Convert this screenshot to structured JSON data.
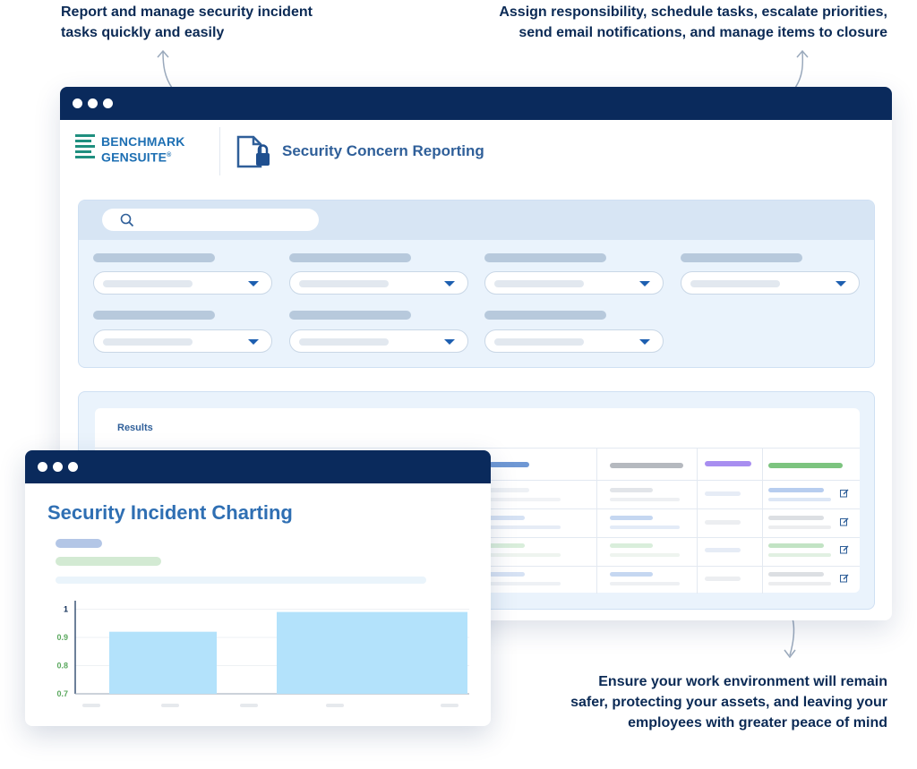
{
  "callouts": {
    "top_left": [
      "Report and manage security incident",
      "tasks quickly and easily"
    ],
    "top_right": [
      "Assign responsibility, schedule tasks, escalate priorities,",
      "send email notifications, and manage items to closure"
    ],
    "bottom_right": [
      "Ensure your work environment will remain",
      "safer, protecting your assets, and leaving your",
      "employees with greater peace of mind"
    ]
  },
  "app": {
    "logo_line1": "BENCHMARK",
    "logo_line2": "GENSUITE",
    "logo_mark": "®",
    "title": "Security Concern Reporting",
    "icon": "document-lock-icon"
  },
  "results": {
    "label": "Results"
  },
  "colors": {
    "titlebar": "#0a2a5c",
    "accent_blue": "#2f6fb3",
    "accent_green": "#7cc47f",
    "accent_purple": "#a88ef0",
    "chart_bar": "#b3e2fb"
  },
  "chart_window": {
    "title": "Security Incident Charting"
  },
  "chart_data": {
    "type": "bar",
    "categories": [
      "",
      ""
    ],
    "values": [
      0.92,
      0.99
    ],
    "y_ticks": [
      "1",
      "0.9",
      "0.8",
      "0.7"
    ],
    "ylim": [
      0.7,
      1.03
    ],
    "grid": true,
    "title": "",
    "xlabel": "",
    "ylabel": ""
  }
}
